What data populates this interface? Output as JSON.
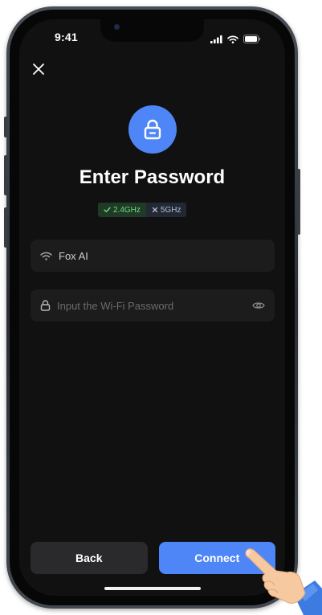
{
  "status_bar": {
    "time": "9:41"
  },
  "screen": {
    "title": "Enter Password",
    "bands": [
      {
        "label": "2.4GHz",
        "state": "supported",
        "icon": "check-icon"
      },
      {
        "label": "5GHz",
        "state": "unsupported",
        "icon": "x-icon"
      }
    ],
    "ssid_field": {
      "value": "Fox AI",
      "icon": "wifi-icon"
    },
    "password_field": {
      "placeholder": "Input the Wi-Fi Password",
      "value": "",
      "icon": "lock-icon",
      "toggle_icon": "eye-icon"
    },
    "buttons": {
      "back": "Back",
      "connect": "Connect"
    }
  },
  "colors": {
    "accent": "#4f86f7",
    "background": "#111111",
    "band_supported": "#6fdc7f",
    "band_unsupported": "#b6bccb"
  }
}
